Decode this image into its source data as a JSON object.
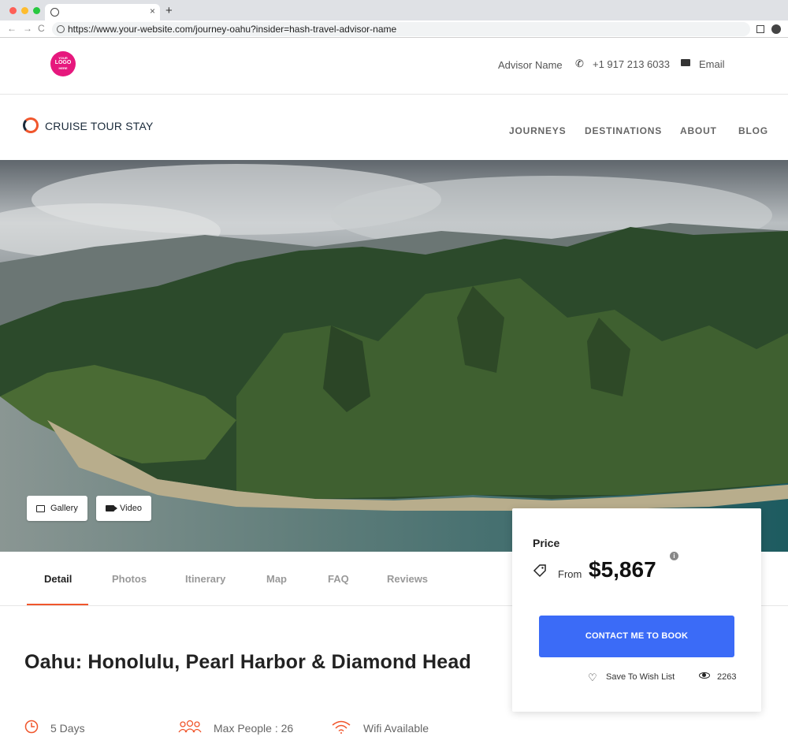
{
  "browser": {
    "url": "https://www.your-website.com/journey-oahu?insider=hash-travel-advisor-name",
    "new_tab": "+",
    "tab_close": "×",
    "back": "←",
    "forward": "→",
    "reload": "C"
  },
  "advisor": {
    "logo_small": "YOUR",
    "logo_main": "LOGO",
    "logo_sub": "HERE",
    "name": "Advisor Name",
    "phone": "+1 917 213 6033",
    "email_label": "Email"
  },
  "nav": {
    "brand": "CRUISE TOUR STAY",
    "items": [
      "JOURNEYS",
      "DESTINATIONS",
      "ABOUT",
      "BLOG"
    ]
  },
  "hero": {
    "gallery_label": "Gallery",
    "video_label": "Video"
  },
  "tabs": [
    "Detail",
    "Photos",
    "Itinerary",
    "Map",
    "FAQ",
    "Reviews"
  ],
  "active_tab": "Detail",
  "trip": {
    "title": "Oahu: Honolulu, Pearl Harbor & Diamond Head",
    "duration": "5 Days",
    "max_people": "Max People : 26",
    "wifi": "Wifi Available"
  },
  "price_card": {
    "label": "Price",
    "from": "From",
    "price": "$5,867",
    "info": "i",
    "book_button": "CONTACT ME TO BOOK",
    "wish_label": "Save To Wish List",
    "views": "2263"
  },
  "colors": {
    "accent": "#f0562c",
    "button": "#3b6bf7",
    "logo": "#e6187d"
  },
  "icons": [
    "phone-icon",
    "mail-icon",
    "gallery-icon",
    "video-icon",
    "tag-icon",
    "info-icon",
    "heart-icon",
    "eye-icon",
    "clock-icon",
    "people-icon",
    "wifi-icon"
  ]
}
